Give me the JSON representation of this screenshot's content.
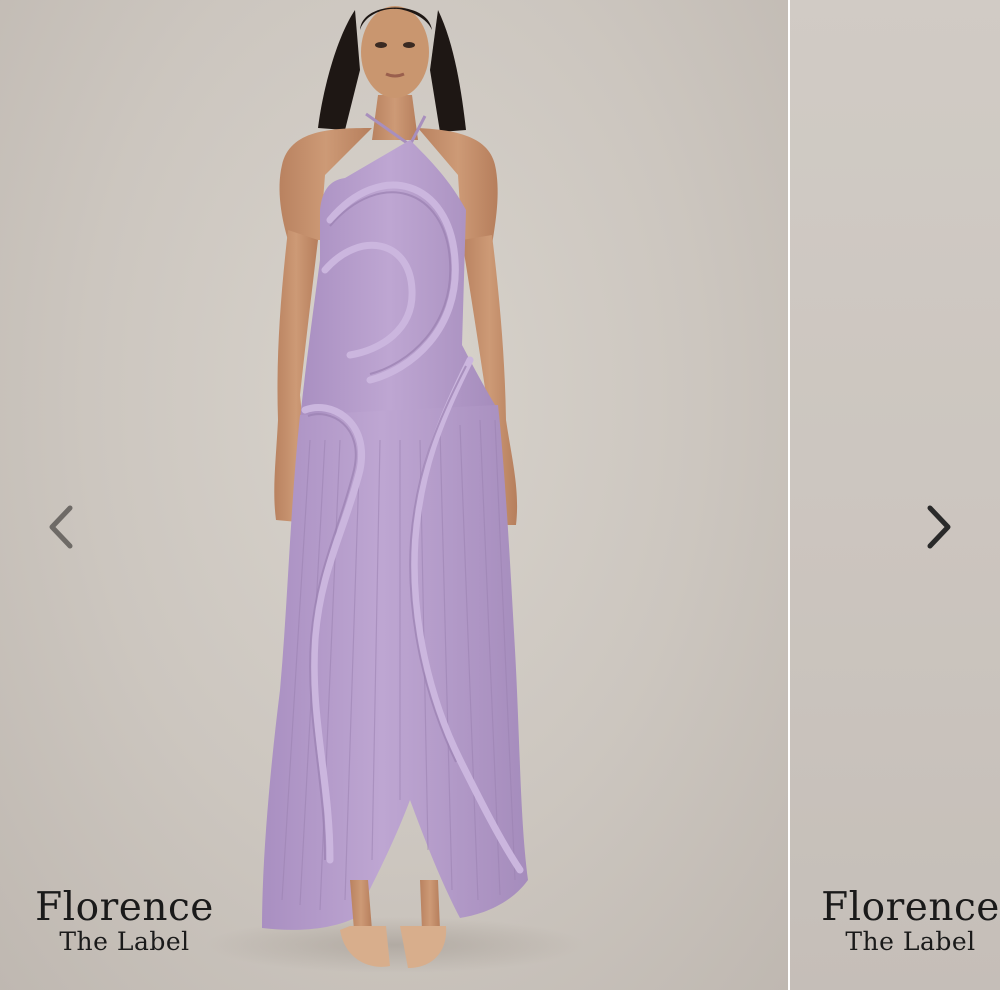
{
  "carousel": {
    "prev_icon": "chevron-left-icon",
    "next_icon": "chevron-right-icon",
    "arrow_colors": {
      "prev": "#6e6a66",
      "next": "#2a2a2a"
    }
  },
  "slides": [
    {
      "brand_line1": "Florence",
      "brand_line2": "The Label"
    },
    {
      "brand_line1": "Florence",
      "brand_line2": "The Label"
    }
  ],
  "colors": {
    "backdrop": "#cfc9c2",
    "dress": "#b79fcc",
    "skin": "#c7916c",
    "hair": "#1e1714",
    "shoes": "#d8ae8c"
  }
}
